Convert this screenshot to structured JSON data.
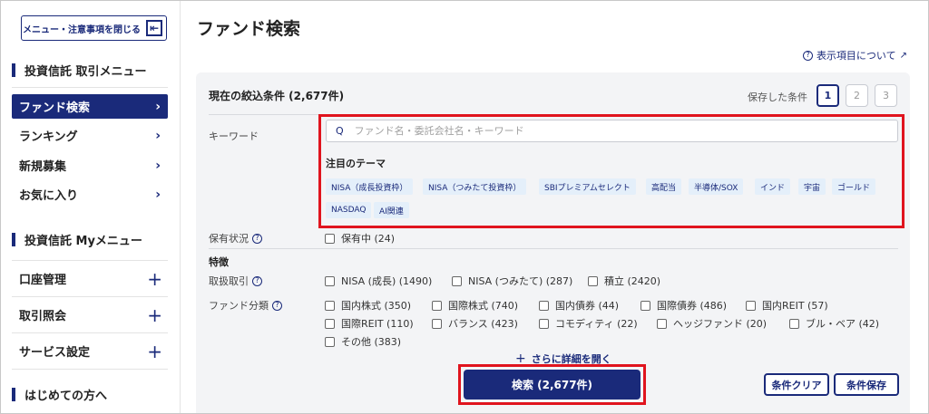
{
  "sidebar": {
    "close_menu_label": "メニュー・注意事項を閉じる",
    "close_icon_glyph": "⇤",
    "section1_title": "投資信託 取引メニュー",
    "items": [
      {
        "label": "ファンド検索",
        "active": true
      },
      {
        "label": "ランキング"
      },
      {
        "label": "新規募集"
      },
      {
        "label": "お気に入り"
      }
    ],
    "section2_title": "投資信託 Myメニュー",
    "my_items": [
      {
        "label": "口座管理"
      },
      {
        "label": "取引照会"
      },
      {
        "label": "サービス設定"
      }
    ],
    "section3_title": "はじめての方へ"
  },
  "main": {
    "title": "ファンド検索",
    "about_link": "表示項目について",
    "conditions_title": "現在の絞込条件 (2,677件)",
    "saved_label": "保存した条件",
    "saved_buttons": [
      "1",
      "2",
      "3"
    ],
    "keyword_label": "キーワード",
    "search_placeholder": "ファンド名・委託会社名・キーワード",
    "theme_title": "注目のテーマ",
    "themes": [
      "NISA（成長投資枠）",
      "NISA（つみたて投資枠）",
      "SBIプレミアムセレクト",
      "高配当",
      "半導体/SOX",
      "インド",
      "宇宙",
      "ゴールド",
      "NASDAQ",
      "AI関連"
    ],
    "holding_label": "保有状況",
    "holding_option": "保有中 (24)",
    "feature_label": "特徴",
    "trade_label": "取扱取引",
    "trade_options": [
      "NISA (成長) (1490)",
      "NISA (つみたて) (287)",
      "積立 (2420)"
    ],
    "category_label": "ファンド分類",
    "category_options": [
      "国内株式 (350)",
      "国際株式 (740)",
      "国内債券 (44)",
      "国際債券 (486)",
      "国内REIT (57)",
      "国際REIT (110)",
      "バランス (423)",
      "コモディティ (22)",
      "ヘッジファンド (20)",
      "ブル・ベア (42)",
      "その他 (383)"
    ],
    "more_link": "さらに詳細を開く",
    "search_button": "検索 (2,677件)",
    "clear_button": "条件クリア",
    "save_button": "条件保存"
  },
  "colors": {
    "brand": "#1a2a7a",
    "highlight": "#e0141e",
    "chip_bg": "#e4effa"
  }
}
